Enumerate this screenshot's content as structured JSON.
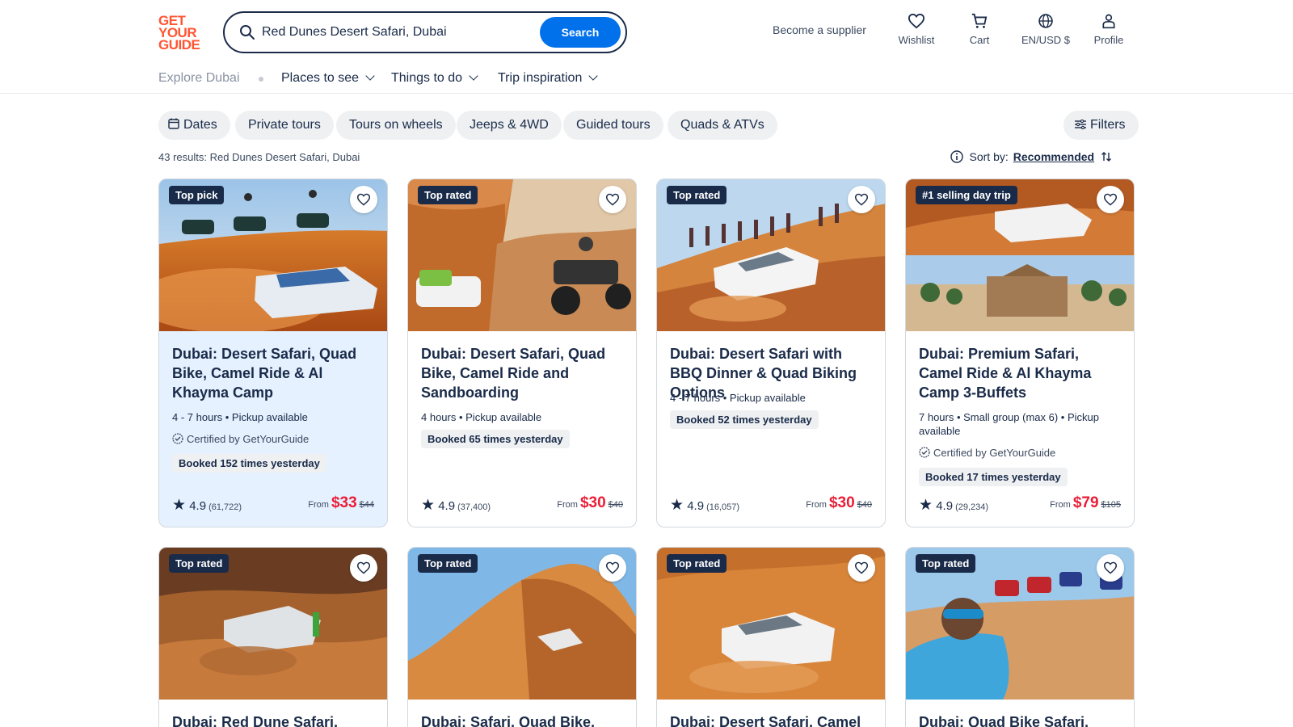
{
  "logo": {
    "line1": "GET",
    "line2": "YOUR",
    "line3": "GUIDE"
  },
  "search": {
    "value": "Red Dunes Desert Safari, Dubai",
    "button": "Search"
  },
  "header": {
    "supplier": "Become a supplier",
    "wishlist": "Wishlist",
    "cart": "Cart",
    "lang": "EN/USD $",
    "profile": "Profile"
  },
  "subnav": {
    "explore": "Explore Dubai",
    "places": "Places to see",
    "things": "Things to do",
    "trip": "Trip inspiration"
  },
  "chips": {
    "dates": "Dates",
    "private": "Private tours",
    "wheels": "Tours on wheels",
    "jeeps": "Jeeps & 4WD",
    "guided": "Guided tours",
    "quads": "Quads & ATVs",
    "filters": "Filters"
  },
  "results": {
    "count": "43 results:",
    "query": "Red Dunes Desert Safari, Dubai"
  },
  "sort": {
    "label": "Sort by:",
    "value": "Recommended"
  },
  "cards": [
    {
      "badge": "Top pick",
      "title": "Dubai: Desert Safari, Quad Bike, Camel Ride & Al Khayma Camp",
      "meta": "4 - 7 hours • Pickup available",
      "cert": "Certified by GetYourGuide",
      "booked": "Booked 152 times yesterday",
      "rating": "4.9",
      "reviews": "(61,722)",
      "from": "From",
      "price": "$33",
      "was": "$44"
    },
    {
      "badge": "Top rated",
      "title": "Dubai: Desert Safari, Quad Bike, Camel Ride and Sandboarding",
      "meta": "4 hours • Pickup available",
      "booked": "Booked 65 times yesterday",
      "rating": "4.9",
      "reviews": "(37,400)",
      "from": "From",
      "price": "$30",
      "was": "$40"
    },
    {
      "badge": "Top rated",
      "title": "Dubai: Desert Safari with BBQ Dinner & Quad Biking Options",
      "meta": "4 - 7 hours • Pickup available",
      "booked": "Booked 52 times yesterday",
      "rating": "4.9",
      "reviews": "(16,057)",
      "from": "From",
      "price": "$30",
      "was": "$40"
    },
    {
      "badge": "#1 selling day trip",
      "title": "Dubai: Premium Safari, Camel Ride & Al Khayma Camp 3-Buffets",
      "meta": "7 hours • Small group (max 6) • Pickup available",
      "cert": "Certified by GetYourGuide",
      "booked": "Booked 17 times yesterday",
      "rating": "4.9",
      "reviews": "(29,234)",
      "from": "From",
      "price": "$79",
      "was": "$105"
    },
    {
      "badge": "Top rated",
      "title": "Dubai: Red Dune Safari, Quad"
    },
    {
      "badge": "Top rated",
      "title": "Dubai: Safari, Quad Bike,"
    },
    {
      "badge": "Top rated",
      "title": "Dubai: Desert Safari, Camel"
    },
    {
      "badge": "Top rated",
      "title": "Dubai: Quad Bike Safari,"
    }
  ]
}
